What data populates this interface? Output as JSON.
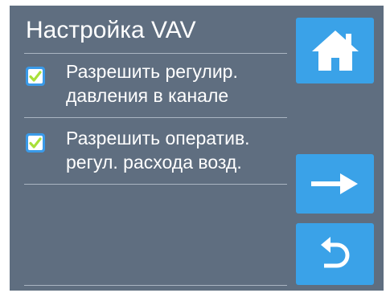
{
  "screen": {
    "title": "Настройка VAV"
  },
  "options": [
    {
      "line1": "Разрешить регулир.",
      "line2": "давления в канале",
      "checked": true
    },
    {
      "line1": "Разрешить оператив.",
      "line2": "регул. расхода возд.",
      "checked": true
    }
  ],
  "nav": {
    "home_icon": "home-icon",
    "next_icon": "arrow-right-icon",
    "back_icon": "return-arrow-icon"
  },
  "colors": {
    "background": "#5f6e80",
    "button": "#3aa2e8",
    "checkbox_border": "#3a9ae8",
    "check_mark": "#a8e03a",
    "text": "#ffffff"
  }
}
